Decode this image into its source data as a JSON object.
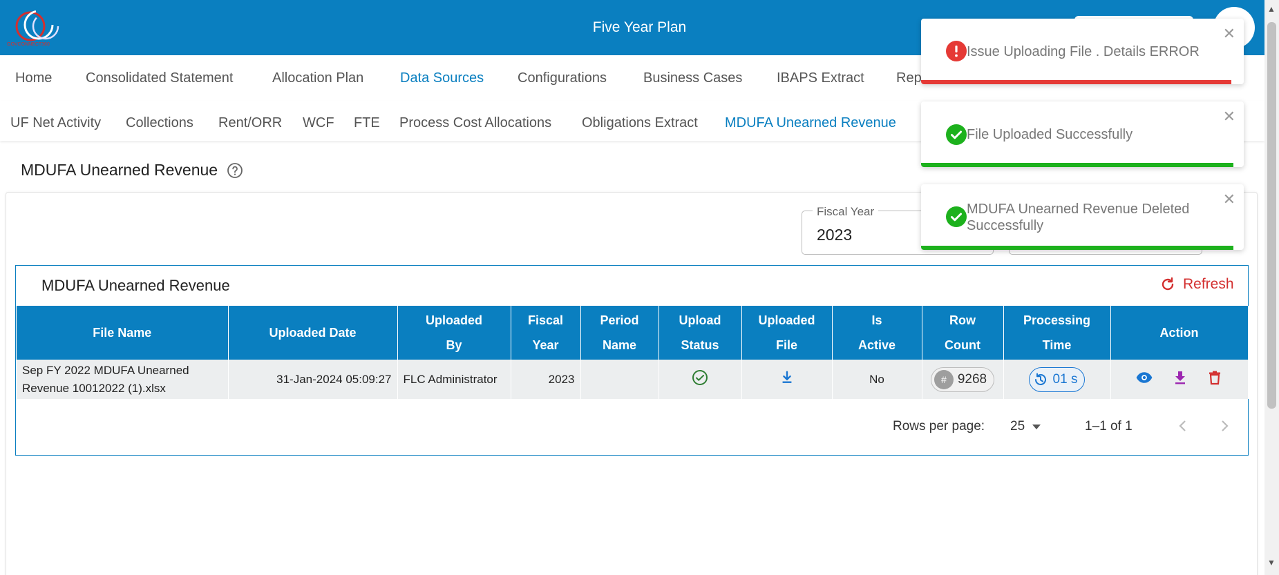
{
  "header": {
    "app_title": "Five Year Plan",
    "avatar_initial": "A",
    "logo_text": "GOVCONNECT360"
  },
  "main_nav": [
    {
      "label": "Home",
      "active": false
    },
    {
      "label": "Consolidated Statement",
      "active": false
    },
    {
      "label": "Allocation Plan",
      "active": false
    },
    {
      "label": "Data Sources",
      "active": true
    },
    {
      "label": "Configurations",
      "active": false
    },
    {
      "label": "Business Cases",
      "active": false
    },
    {
      "label": "IBAPS Extract",
      "active": false
    },
    {
      "label": "Rep",
      "active": false
    }
  ],
  "sub_nav": [
    {
      "label": "UF Net Activity",
      "active": false
    },
    {
      "label": "Collections",
      "active": false
    },
    {
      "label": "Rent/ORR",
      "active": false
    },
    {
      "label": "WCF",
      "active": false
    },
    {
      "label": "FTE",
      "active": false
    },
    {
      "label": "Process Cost Allocations",
      "active": false
    },
    {
      "label": "Obligations Extract",
      "active": false
    },
    {
      "label": "MDUFA Unearned Revenue",
      "active": true
    }
  ],
  "page": {
    "title": "MDUFA Unearned Revenue"
  },
  "filters": {
    "fiscal_year_label": "Fiscal Year",
    "fiscal_year_value": "2023"
  },
  "grid": {
    "title": "MDUFA Unearned Revenue",
    "refresh_label": "Refresh",
    "columns": [
      "File Name",
      "Uploaded Date",
      "Uploaded By",
      "Fiscal Year",
      "Period Name",
      "Upload Status",
      "Uploaded File",
      "Is Active",
      "Row Count",
      "Processing Time",
      "Action"
    ],
    "column_lines": [
      [
        "File Name"
      ],
      [
        "Uploaded Date"
      ],
      [
        "Uploaded",
        "By"
      ],
      [
        "Fiscal",
        "Year"
      ],
      [
        "Period",
        "Name"
      ],
      [
        "Upload",
        "Status"
      ],
      [
        "Uploaded",
        "File"
      ],
      [
        "Is",
        "Active"
      ],
      [
        "Row",
        "Count"
      ],
      [
        "Processing",
        "Time"
      ],
      [
        "Action"
      ]
    ],
    "rows": [
      {
        "file_name": "Sep FY 2022 MDUFA Unearned Revenue 10012022 (1).xlsx",
        "uploaded_date": "31-Jan-2024 05:09:27",
        "uploaded_by": "FLC Administrator",
        "fiscal_year": "2023",
        "period_name": "",
        "upload_status_icon": "check-circle-icon",
        "uploaded_file_icon": "download-icon",
        "is_active": "No",
        "row_count_prefix": "#",
        "row_count": "9268",
        "processing_time": "01 s"
      }
    ]
  },
  "pagination": {
    "rows_per_page_label": "Rows per page:",
    "rows_per_page_value": "25",
    "range_text": "1–1 of 1"
  },
  "toasts": [
    {
      "type": "error",
      "message": "Issue Uploading File . Details ERROR",
      "color": "#e53935",
      "icon": "error-icon"
    },
    {
      "type": "success",
      "message": "File Uploaded Successfully",
      "color": "#1db11d",
      "icon": "success-icon"
    },
    {
      "type": "success",
      "message": "MDUFA Unearned Revenue Deleted Successfully",
      "color": "#1db11d",
      "icon": "success-icon"
    }
  ],
  "colors": {
    "primary": "#0a7fc0",
    "danger": "#d32f2f",
    "success": "#1db11d",
    "download_purple": "#9c27b0"
  }
}
